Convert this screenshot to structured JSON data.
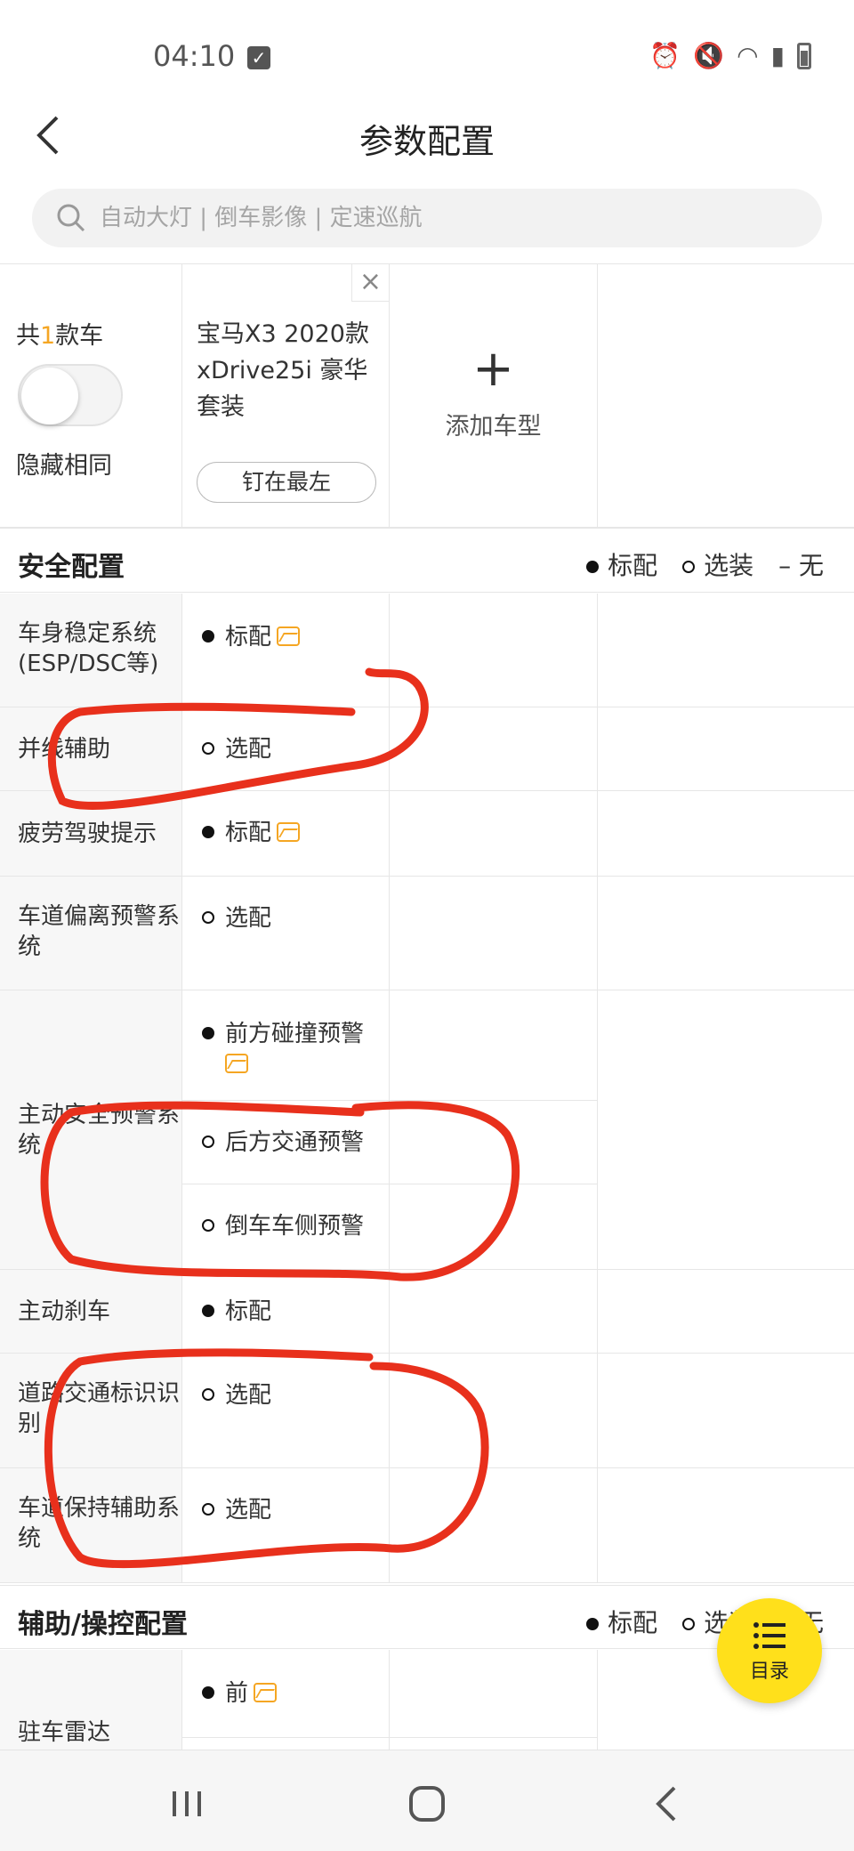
{
  "status_bar": {
    "time": "04:10"
  },
  "header": {
    "title": "参数配置"
  },
  "search": {
    "placeholder": "自动大灯 | 倒车影像 | 定速巡航"
  },
  "car_header": {
    "count_prefix": "共",
    "count": "1",
    "count_suffix": "款车",
    "hide_same_label": "隐藏相同",
    "hide_same_on": false,
    "car_name": "宝马X3 2020款 xDrive25i 豪华套装",
    "pin_label": "钉在最左",
    "add_label": "添加车型"
  },
  "legend": {
    "standard": "标配",
    "optional": "选装",
    "none": "– 无"
  },
  "sections": [
    {
      "title": "安全配置",
      "rows": [
        {
          "label": "车身稳定系统(ESP/DSC等)",
          "values": [
            {
              "mark": "filled",
              "text": "标配",
              "has_image": true
            }
          ]
        },
        {
          "label": "并线辅助",
          "values": [
            {
              "mark": "ring",
              "text": "选配"
            }
          ]
        },
        {
          "label": "疲劳驾驶提示",
          "values": [
            {
              "mark": "filled",
              "text": "标配",
              "has_image": true
            }
          ]
        },
        {
          "label": "车道偏离预警系统",
          "values": [
            {
              "mark": "ring",
              "text": "选配"
            }
          ]
        },
        {
          "label": "主动安全预警系统",
          "values": [
            {
              "mark": "filled",
              "text": "前方碰撞预警",
              "has_image": true
            },
            {
              "mark": "ring",
              "text": "后方交通预警"
            },
            {
              "mark": "ring",
              "text": "倒车车侧预警"
            }
          ]
        },
        {
          "label": "主动刹车",
          "values": [
            {
              "mark": "filled",
              "text": "标配"
            }
          ]
        },
        {
          "label": "道路交通标识识别",
          "values": [
            {
              "mark": "ring",
              "text": "选配"
            }
          ]
        },
        {
          "label": "车道保持辅助系统",
          "values": [
            {
              "mark": "ring",
              "text": "选配"
            }
          ]
        }
      ]
    },
    {
      "title": "辅助/操控配置",
      "rows": [
        {
          "label": "驻车雷达",
          "values": [
            {
              "mark": "filled",
              "text": "前",
              "has_image": true
            }
          ]
        }
      ]
    }
  ],
  "catalog_button": {
    "label": "目录"
  },
  "colors": {
    "accent": "#ffe01b",
    "highlight": "#f5a623",
    "annotation": "#e8301c"
  }
}
